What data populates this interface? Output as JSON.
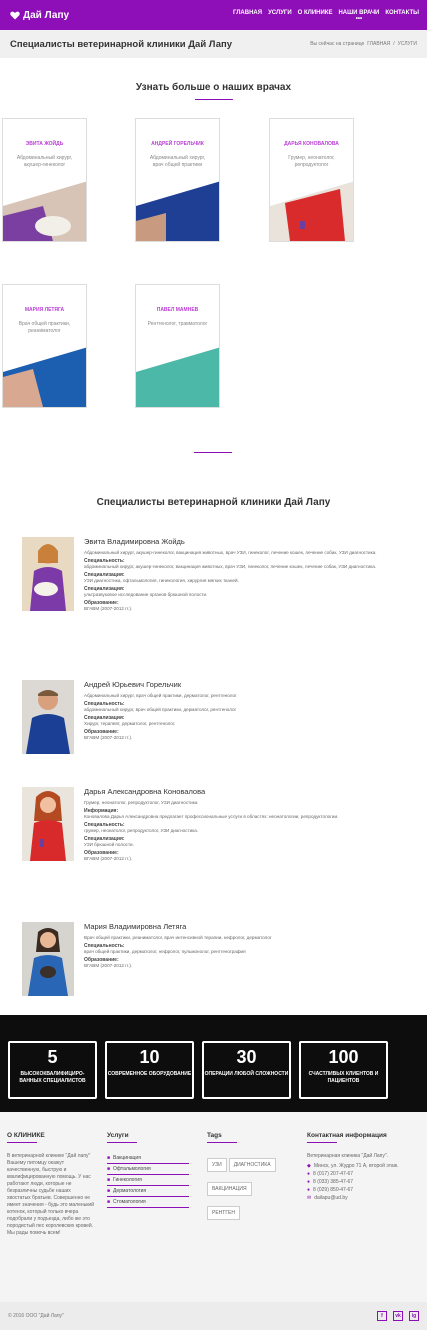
{
  "header": {
    "logo": "Дай Лапу",
    "nav": [
      "ГЛАВНАЯ",
      "УСЛУГИ",
      "О КЛИНИКЕ",
      "НАШИ ВРАЧИ",
      "КОНТАКТЫ"
    ],
    "nav_dots": "•••"
  },
  "breadcrumb": {
    "title": "Специалисты ветеринарной клиники Дай Лапу",
    "prefix": "Вы сейчас на странице",
    "items": [
      "ГЛАВНАЯ",
      "/",
      "УСЛУГИ"
    ]
  },
  "cards_section": {
    "title": "Узнать больше о наших врачах",
    "cards": [
      {
        "name": "ЭВИТА ЖОЙДЬ",
        "role": "Абдоминальный хирург, акушер-гинеколог"
      },
      {
        "name": "АНДРЕЙ ГОРЕЛЬЧИК",
        "role": "Абдоминальный хирург, врач общей практики"
      },
      {
        "name": "ДАРЬЯ КОНОВАЛОВА",
        "role": "Грумер, неонатолог, репродуктолог"
      },
      {
        "name": "МАРИЯ ЛЕТЯГА",
        "role": "Врач общей практики, реаниматолог"
      },
      {
        "name": "ПАВЕЛ МАМНЕВ",
        "role": "Рентгенолог, травматолог"
      }
    ]
  },
  "doctors_section": {
    "title": "Специалисты ветеринарной клиники Дай Лапу",
    "doctors": [
      {
        "name": "Эвита Владимировна Жойдь",
        "summary": "Абдоминальный хирург, акушер-гинеколог, вакцинация животных, врач УЗИ, гинеколог, лечение кошек, лечение собак, УЗИ диагностика.",
        "blocks": [
          {
            "label": "Специальность:",
            "text": "абдоминальный хирург, акушер-гинеколог, вакцинация животных, врач УЗИ, гинеколог, лечение кошек, лечение собак, УЗИ диагностика."
          },
          {
            "label": "Специализация:",
            "text": "УЗИ диагностика, офтальмология, гинекология, хирургия мягких тканей."
          },
          {
            "label": "Специализация:",
            "text": "ультразвуковое исследование органов брюшной полости."
          },
          {
            "label": "Образование:",
            "text": "ВГАВМ (2007-2012 гг.)."
          }
        ]
      },
      {
        "name": "Андрей Юрьевич Горельчик",
        "summary": "Абдоминальный хирург, врач общей практики, дерматолог, рентгенолог",
        "blocks": [
          {
            "label": "Специальность:",
            "text": "абдоминальный хирург, врач общей практики, дерматолог, рентгенолог"
          },
          {
            "label": "Специализация:",
            "text": "Хирург, терапевт, дерматолог, рентгенолог."
          },
          {
            "label": "Образование:",
            "text": "ВГАВМ (2007-2012 гг.)."
          }
        ]
      },
      {
        "name": "Дарья Александровна Коновалова",
        "summary": "Грумер, неонатолог, репродуктолог, УЗИ диагностика",
        "blocks": [
          {
            "label": "Информация:",
            "text": "Коновалова Дарья Александровна предлагает профессиональные услуги в областях: неонатологии, репродуктологии."
          },
          {
            "label": "Специальность:",
            "text": "грумер, неонатолог, репродуктолог, УЗИ диагностика."
          },
          {
            "label": "Специализация:",
            "text": "УЗИ брюшной полости."
          },
          {
            "label": "Образование:",
            "text": "ВГАВМ (2007-2012 гг.)."
          }
        ]
      },
      {
        "name": "Мария Владимировна Летяга",
        "summary": "Врач общей практики, реаниматолог, врач интенсивной терапии, нефролог, дерматолог",
        "blocks": [
          {
            "label": "Специальность:",
            "text": "врач общей практики, дерматолог, нефролог, пульмонолог, рентгенография"
          },
          {
            "label": "Образование:",
            "text": "ВГАВМ (2007-2012 гг.)."
          }
        ]
      }
    ]
  },
  "stats": [
    {
      "num": "5",
      "text": "ВЫСОКОКВАЛИФИЦИРО-ВАННЫХ СПЕЦИАЛИСТОВ"
    },
    {
      "num": "10",
      "text": "СОВРЕМЕННОЕ ОБОРУДОВАНИЕ"
    },
    {
      "num": "30",
      "text": "ОПЕРАЦИИ ЛЮБОЙ СЛОЖНОСТИ"
    },
    {
      "num": "100",
      "text": "СЧАСТЛИВЫХ КЛИЕНТОВ И ПАЦИЕНТОВ"
    }
  ],
  "footer": {
    "about_title": "О КЛИНИКЕ",
    "about_text": "В ветеринарной клинике \"Дай лапу\" Вашему питомцу окажут качественную, быструю и квалифицированную помощь. У нас работают люди, которые не безразличны судьбе наших хвостатых братьев. Совершенно не имеет значения - будь это маленький котенок, который только вчера подобрали у подъезда, либо же это породистый пес королевских кровей. Мы рады помочь всем!",
    "services_title": "Услуги",
    "services": [
      "Вакцинация",
      "Офтальмология",
      "Гинекология",
      "Дерматология",
      "Стоматология"
    ],
    "tags_title": "Tags",
    "tags": [
      "УЗИ",
      "ДИАГНОСТИКА",
      "ВАКЦИНАЦИЯ",
      "РЕНТГЕН"
    ],
    "contacts_title": "Контактная информация",
    "contacts_intro": "Ветеринарная клиника \"Дай Лапу\".",
    "contacts": [
      {
        "icon": "map-pin-icon",
        "text": "Минск, ул. Жудро 71 А, второй этаж."
      },
      {
        "icon": "phone-icon",
        "text": "8 (017) 207-47-67"
      },
      {
        "icon": "phone-icon",
        "text": "8 (033) 385-47-67"
      },
      {
        "icon": "phone-icon",
        "text": "8 (029) 850-47-67"
      },
      {
        "icon": "mail-icon",
        "text": "dailapu@ud.by"
      }
    ],
    "copyright": "© 2016 ООО \"Дай Лапу\"",
    "socials": [
      "f",
      "vk",
      "ig"
    ]
  },
  "colors": {
    "brand": "#8e0fb8",
    "accent_teal": "#4cb8a8",
    "card_name": "#b93cd6"
  }
}
